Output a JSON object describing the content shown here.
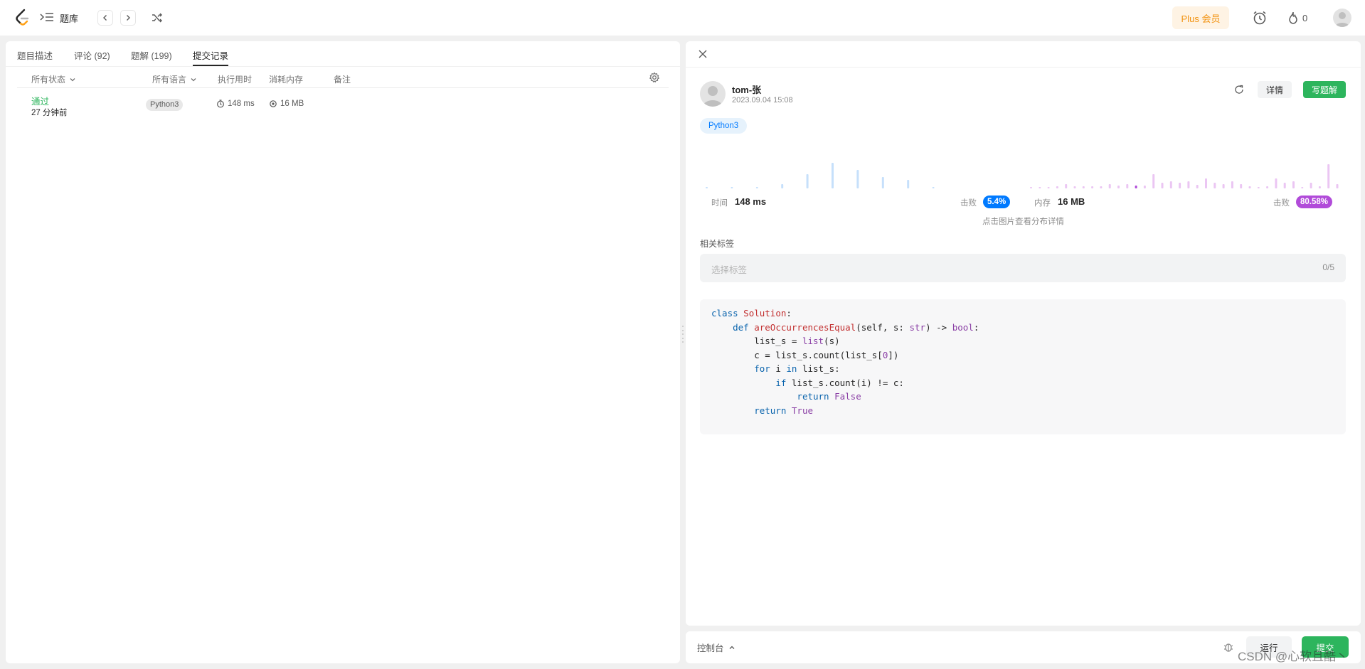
{
  "nav": {
    "problemset_label": "题库",
    "plus_label": "Plus 会员",
    "streak_count": "0",
    "icons": [
      "logo-icon",
      "list-icon",
      "chevron-left-icon",
      "chevron-right-icon",
      "shuffle-icon",
      "alarm-icon",
      "fire-icon",
      "avatar-icon"
    ]
  },
  "left": {
    "tabs": [
      {
        "label": "题目描述",
        "active": false
      },
      {
        "label": "评论 (92)",
        "active": false
      },
      {
        "label": "题解 (199)",
        "active": false
      },
      {
        "label": "提交记录",
        "active": true
      }
    ],
    "columns": {
      "status": "所有状态",
      "language": "所有语言",
      "runtime": "执行用时",
      "memory": "消耗内存",
      "notes": "备注"
    },
    "rows": [
      {
        "status": "通过",
        "time_ago": "27 分钟前",
        "language": "Python3",
        "runtime": "148 ms",
        "memory": "16 MB",
        "notes": ""
      }
    ]
  },
  "detail": {
    "user": "tom-张",
    "submitted_at": "2023.09.04 15:08",
    "detail_label": "详情",
    "write_solution_label": "写题解",
    "language": "Python3",
    "runtime": {
      "label": "时间",
      "value": "148 ms",
      "beats_label": "击败",
      "beats": "5.4%"
    },
    "memory": {
      "label": "内存",
      "value": "16 MB",
      "beats_label": "击败",
      "beats": "80.58%"
    },
    "chart_hint": "点击图片查看分布详情",
    "tags_title": "相关标签",
    "tags_placeholder": "选择标签",
    "tags_count": "0/5",
    "colors": {
      "accent_green": "#2db55d",
      "runtime_blue": "#007aff",
      "memory_purple": "#b14bd9"
    },
    "code_lines": [
      "class Solution:",
      "    def areOccurrencesEqual(self, s: str) -> bool:",
      "        list_s = list(s)",
      "        c = list_s.count(list_s[0])",
      "        for i in list_s:",
      "            if list_s.count(i) != c:",
      "                return False",
      "        return True"
    ]
  },
  "bottom": {
    "console_label": "控制台",
    "run_label": "运行",
    "submit_label": "提交"
  },
  "watermark": "CSDN @心软且酷丶"
}
